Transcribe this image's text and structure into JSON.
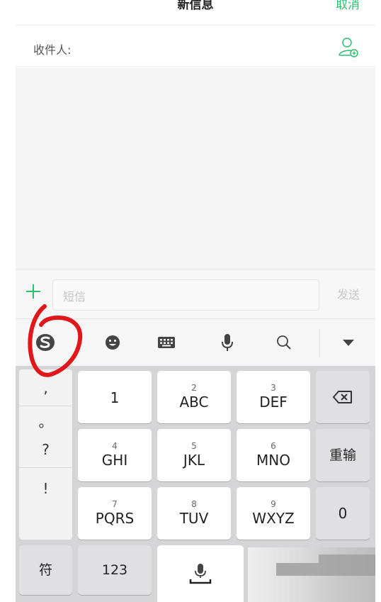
{
  "header": {
    "title": "新信息",
    "cancel_label": "取消"
  },
  "recipient": {
    "label": "收件人:",
    "add_icon": "add-contact-icon"
  },
  "compose": {
    "placeholder": "短信",
    "send_label": "发送",
    "plus_icon": "plus-icon"
  },
  "toolbar": {
    "icons": [
      "sogou-logo-icon",
      "emoji-icon",
      "keyboard-icon",
      "microphone-icon",
      "search-icon",
      "collapse-arrow-icon"
    ]
  },
  "keyboard": {
    "punctuation": [
      ",",
      "。",
      "?",
      "!"
    ],
    "keys": [
      {
        "num": "",
        "main": "1"
      },
      {
        "num": "2",
        "main": "ABC"
      },
      {
        "num": "3",
        "main": "DEF"
      },
      {
        "num": "4",
        "main": "GHI"
      },
      {
        "num": "5",
        "main": "JKL"
      },
      {
        "num": "6",
        "main": "MNO"
      },
      {
        "num": "7",
        "main": "PQRS"
      },
      {
        "num": "8",
        "main": "TUV"
      },
      {
        "num": "9",
        "main": "WXYZ"
      }
    ],
    "retype_label": "重输",
    "zero_label": "0",
    "symbol_label": "符",
    "numbers_label": "123",
    "backspace_icon": "backspace-icon",
    "space_icon": "microphone-space-icon"
  },
  "colors": {
    "accent": "#2bbf6f",
    "annotation": "#e0161b"
  }
}
